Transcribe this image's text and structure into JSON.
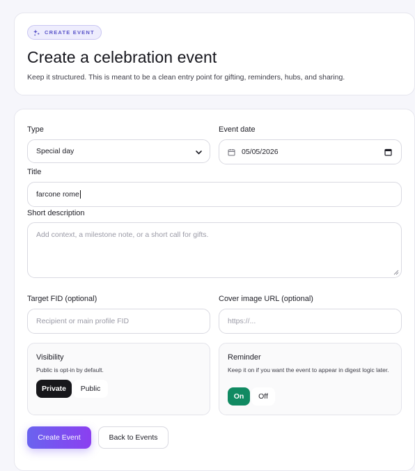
{
  "header": {
    "badge": "CREATE EVENT",
    "title": "Create a celebration event",
    "subtitle": "Keep it structured. This is meant to be a clean entry point for gifting, reminders, hubs, and sharing."
  },
  "form": {
    "type": {
      "label": "Type",
      "value": "Special day"
    },
    "event_date": {
      "label": "Event date",
      "value": "05/05/2026"
    },
    "title": {
      "label": "Title",
      "value": "farcone rome"
    },
    "description": {
      "label": "Short description",
      "placeholder": "Add context, a milestone note, or a short call for gifts."
    },
    "target_fid": {
      "label": "Target FID (optional)",
      "placeholder": "Recipient or main profile FID"
    },
    "cover_url": {
      "label": "Cover image URL (optional)",
      "placeholder": "https://..."
    },
    "visibility": {
      "title": "Visibility",
      "note": "Public is opt-in by default.",
      "options": [
        "Private",
        "Public"
      ],
      "selected": "Private"
    },
    "reminder": {
      "title": "Reminder",
      "note": "Keep it on if you want the event to appear in digest logic later.",
      "options": [
        "On",
        "Off"
      ],
      "selected": "On"
    }
  },
  "actions": {
    "create": "Create Event",
    "back": "Back to Events"
  },
  "colors": {
    "accent": "#6a63ef",
    "accent_end": "#8b3ff0",
    "badge_text": "#5b55c9",
    "dark": "#17171b",
    "green": "#118a62"
  },
  "icons": {
    "badge": "sparkles-icon",
    "select": "chevron-down-icon",
    "date": "calendar-icon"
  }
}
